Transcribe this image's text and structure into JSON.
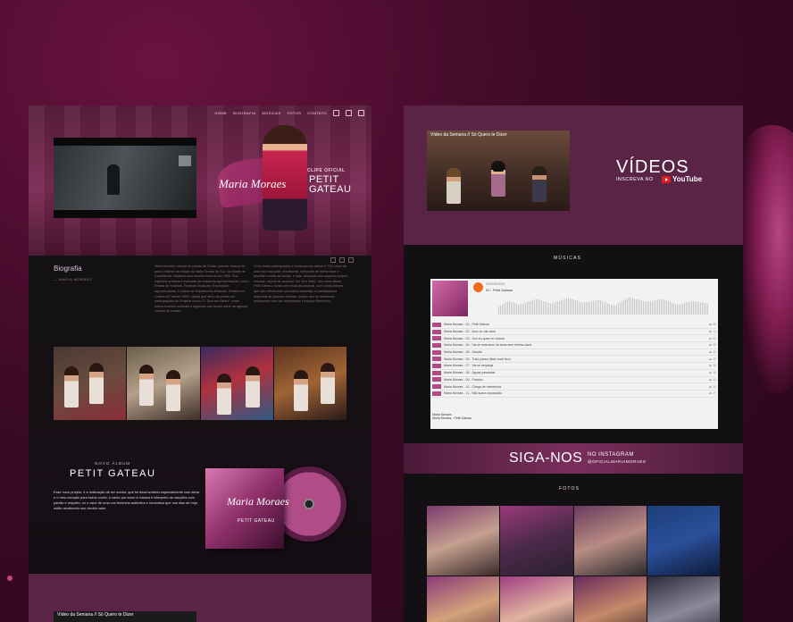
{
  "nav": {
    "items": [
      "HOME",
      "BIOGRAFIA",
      "MÚSICAS",
      "FOTOS",
      "CONTATO"
    ]
  },
  "hero": {
    "brand": "Maria Moraes",
    "clip_label": "CLIPE OFICIAL",
    "clip_title": "PETIT GATEAU"
  },
  "bio": {
    "title": "Biografia",
    "author": "— MARIA MORAES",
    "col1": "Maria Moraes, natural do estado de Goiás, quando criança foi para o interior do estado do Mato Grosso do Sul, na cidade de Cassilândia, iniciando sua carreira musical em 1996. Sua trajetória artística é marcada por inúmeras apresentações, como Festas de Rodeios, Festivais Musicais, Exposições Agropecuárias, e Casas de Espetáculos Musicais. Reside em Cuiabá-MT desde 1999, capital que abriu as portas em participações de Projetos como: O \"Dua seu Bairro\", entre outros eventos culturais e regionais que fazem parte da agenda cultural do estado.",
    "col2": "Com várias participações e presença em rádios e TVs, dona de uma voz marcante, envolvente, intérprete de forma doce e peculiar o estilo sertanejo, e hoje, lançando seu segundo projeto musical, depois do sucesso \"Ao Vivo Mais\", seu novo álbum Petit Gateau, conta com músicas autorais, com compositores que são referências na música sertaneja, e participações especiais de grandes artistas, projeto que foi idealizado juntamente com seu empresário e esposo Reinoerto."
  },
  "album": {
    "pre": "NOVO ÁLBUM",
    "title": "PETIT GATEAU",
    "text": "Esse novo projeto, é a realização de um sonho, que foi desenvolvido especialmente com alma e o meu coração para todos vocês, e canto por amor à música e interpreto as canções com paixão e respeito, só o valor de uma voz feminina autêntica e romântica que nos dias de hoje, estão recebendo seu devido valor",
    "cd_name": "Maria Moraes",
    "cd_sub": "PETIT GATEAU"
  },
  "left_bottom": {
    "video_title": "Vídeo da Semana // Só Quero te Dizer"
  },
  "videos": {
    "video_title": "Vídeo da Semana // Só Quero te Dizer",
    "title": "VÍDEOS",
    "subscribe": "INSCREVA NO",
    "youtube": "YouTube"
  },
  "musicas": {
    "heading": "MÚSICAS",
    "artist": "DISCATORIO",
    "now_playing": "01 - Petit Gateau",
    "tracks": [
      {
        "title": "Maria Moraes - 01 - Petit Gateau",
        "count": "▶ 96"
      },
      {
        "title": "Maria Moraes - 02 - Amo ou não ama",
        "count": "▶ 74"
      },
      {
        "title": "Maria Moraes - 03 - Sou eu quem te chama",
        "count": "▶ 62"
      },
      {
        "title": "Maria Moraes - 04 - Vai se esta seus há tanta sem mimha cana",
        "count": "▶ 59"
      },
      {
        "title": "Maria Moraes - 05 - Garção",
        "count": "▶ 44"
      },
      {
        "title": "Maria Moraes - 06 - Tudo passa (fiiwe cocê fico)",
        "count": "▶ 40"
      },
      {
        "title": "Maria Moraes - 07 - Vai se esquega",
        "count": "▶ 38"
      },
      {
        "title": "Maria Moraes - 08 - Águas passadas",
        "count": "▶ 35"
      },
      {
        "title": "Maria Moraes - 09 - Paraíso",
        "count": "▶ 33"
      },
      {
        "title": "Maria Moraes - 10 - Chega de mentirinha",
        "count": "▶ 30"
      },
      {
        "title": "Maria Moraes - 11 - Não suara separação",
        "count": "▶ 27"
      }
    ],
    "footer_artist": "Maria Moraes",
    "footer_track": "Maria Moraes - Petit Gateau"
  },
  "siga": {
    "title": "SIGA-NOS",
    "sub1": "NO INSTAGRAM",
    "sub2": "@OFICIALMARIAMORAES"
  },
  "fotos": {
    "heading": "FOTOS"
  }
}
